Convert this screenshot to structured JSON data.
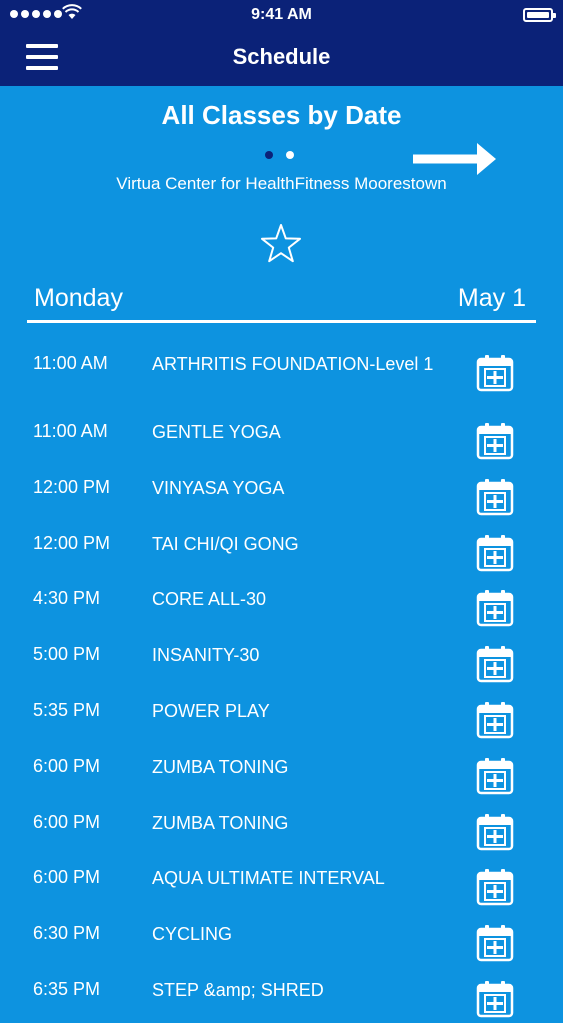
{
  "status_bar": {
    "time": "9:41 AM",
    "signal_icon": "signal-dots-icon",
    "wifi_icon": "wifi-icon",
    "battery_icon": "battery-icon"
  },
  "nav": {
    "title": "Schedule",
    "menu_icon": "hamburger-menu-icon"
  },
  "header": {
    "title": "All Classes by Date",
    "location": "Virtua Center for HealthFitness Moorestown",
    "next_icon": "arrow-right-icon",
    "favorite_icon": "star-outline-icon",
    "pages": 2,
    "current_page": 1
  },
  "day": {
    "name": "Monday",
    "date": "May 1"
  },
  "classes": [
    {
      "time": "11:00 AM",
      "name": "ARTHRITIS FOUNDATION-Level 1"
    },
    {
      "time": "11:00 AM",
      "name": "GENTLE YOGA"
    },
    {
      "time": "12:00 PM",
      "name": "VINYASA YOGA"
    },
    {
      "time": "12:00 PM",
      "name": "TAI CHI/QI GONG"
    },
    {
      "time": "4:30 PM",
      "name": "CORE ALL-30"
    },
    {
      "time": "5:00 PM",
      "name": "INSANITY-30"
    },
    {
      "time": "5:35 PM",
      "name": "POWER PLAY"
    },
    {
      "time": "6:00 PM",
      "name": "ZUMBA TONING"
    },
    {
      "time": "6:00 PM",
      "name": "ZUMBA TONING"
    },
    {
      "time": "6:00 PM",
      "name": "AQUA ULTIMATE INTERVAL"
    },
    {
      "time": "6:30 PM",
      "name": "CYCLING"
    },
    {
      "time": "6:35 PM",
      "name": "STEP &amp; SHRED"
    }
  ],
  "add_to_calendar_icon": "calendar-add-icon",
  "colors": {
    "background": "#0d93e0",
    "nav": "#0b2278",
    "text": "#ffffff"
  }
}
